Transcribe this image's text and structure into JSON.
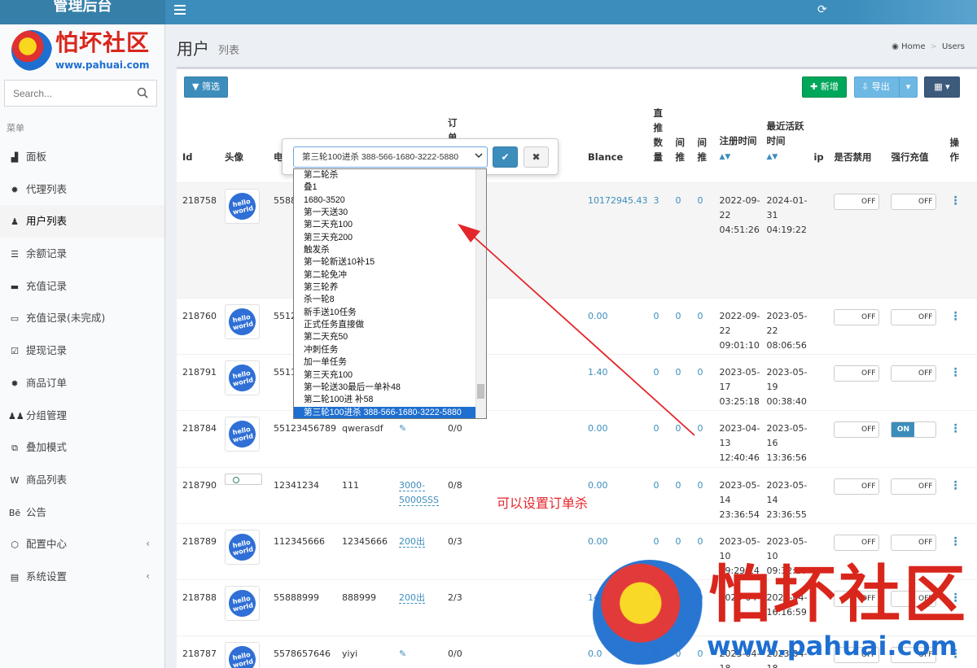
{
  "brand": {
    "title": "管理后台"
  },
  "logo": {
    "title": "怕坏社区",
    "url": "www.pahuai.com"
  },
  "search": {
    "placeholder": "Search..."
  },
  "sidebar": {
    "header": "菜单",
    "items": [
      {
        "label": "面板",
        "icon": "dashboard-icon"
      },
      {
        "label": "代理列表",
        "icon": "gear-icon"
      },
      {
        "label": "用户列表",
        "icon": "user-icon",
        "active": true
      },
      {
        "label": "余额记录",
        "icon": "list-icon"
      },
      {
        "label": "充值记录",
        "icon": "card-icon"
      },
      {
        "label": "充值记录(未完成)",
        "icon": "card-outline-icon"
      },
      {
        "label": "提现记录",
        "icon": "check-square-icon"
      },
      {
        "label": "商品订单",
        "icon": "gear-icon"
      },
      {
        "label": "分组管理",
        "icon": "users-icon"
      },
      {
        "label": "叠加模式",
        "icon": "layers-icon"
      },
      {
        "label": "商品列表",
        "icon": "product-icon"
      },
      {
        "label": "公告",
        "icon": "behance-icon"
      },
      {
        "label": "配置中心",
        "icon": "cog-icon",
        "chevron": true
      },
      {
        "label": "系统设置",
        "icon": "settings-icon",
        "chevron": true
      }
    ]
  },
  "header": {
    "title": "用户",
    "subtitle": "列表"
  },
  "breadcrumb": {
    "home": "Home",
    "current": "Users"
  },
  "toolbar": {
    "filter": "筛选",
    "add": "新增",
    "export": "导出"
  },
  "table": {
    "columns": {
      "id": "Id",
      "avatar": "头像",
      "phone": "电",
      "order": "订单",
      "balance": "Blance",
      "direct": "直推数量",
      "indirect1": "间推",
      "indirect2": "间推",
      "register": "注册时间",
      "last_active": "最近活跃时间",
      "ip": "ip",
      "disabled": "是否禁用",
      "force": "强行充值",
      "ops": "操作"
    },
    "rows": [
      {
        "id": "218758",
        "phone": "5588",
        "name": "",
        "task": "",
        "order": "",
        "balance": "10172945.43",
        "direct": "3",
        "i1": "0",
        "i2": "0",
        "reg_d": "2022-09-22",
        "reg_t": "04:51:26",
        "act_d": "2024-01-31",
        "act_t": "04:19:22",
        "disabled": "OFF",
        "force": "OFF"
      },
      {
        "id": "218760",
        "phone": "5512",
        "name": "",
        "task": "",
        "order": "",
        "balance": "0.00",
        "direct": "0",
        "i1": "0",
        "i2": "0",
        "reg_d": "2022-09-22",
        "reg_t": "09:01:10",
        "act_d": "2023-05-22",
        "act_t": "08:06:56",
        "disabled": "OFF",
        "force": "OFF"
      },
      {
        "id": "218791",
        "phone": "5511",
        "name": "",
        "task": "",
        "order": "",
        "balance": "1.40",
        "direct": "0",
        "i1": "0",
        "i2": "0",
        "reg_d": "2023-05-17",
        "reg_t": "03:25:18",
        "act_d": "2023-05-19",
        "act_t": "00:38:40",
        "disabled": "OFF",
        "force": "OFF"
      },
      {
        "id": "218784",
        "phone": "55123456789",
        "name": "qwerasdf",
        "task": "",
        "order": "0/0",
        "balance": "0.00",
        "direct": "0",
        "i1": "0",
        "i2": "0",
        "reg_d": "2023-04-13",
        "reg_t": "12:40:46",
        "act_d": "2023-05-16",
        "act_t": "13:36:56",
        "disabled": "OFF",
        "force": "ON"
      },
      {
        "id": "218790",
        "phone": "12341234",
        "name": "111",
        "task": "3000-5000SSS",
        "order": "0/8",
        "balance": "0.00",
        "direct": "0",
        "i1": "0",
        "i2": "0",
        "reg_d": "2023-05-14",
        "reg_t": "23:36:54",
        "act_d": "2023-05-14",
        "act_t": "23:36:55",
        "disabled": "OFF",
        "force": "OFF"
      },
      {
        "id": "218789",
        "phone": "112345666",
        "name": "12345666",
        "task": "200出",
        "order": "0/3",
        "balance": "0.00",
        "direct": "0",
        "i1": "0",
        "i2": "0",
        "reg_d": "2023-05-10",
        "reg_t": "09:29:14",
        "act_d": "2023-05-10",
        "act_t": "09:32:10",
        "disabled": "OFF",
        "force": "OFF"
      },
      {
        "id": "218788",
        "phone": "55888999",
        "name": "888999",
        "task": "200出",
        "order": "2/3",
        "balance": "143",
        "direct": "0",
        "i1": "0",
        "i2": "0",
        "reg_d": "2023-04-",
        "reg_t": "",
        "act_d": "2023-04-",
        "act_t": "16:16:59",
        "disabled": "OFF",
        "force": "OFF"
      },
      {
        "id": "218787",
        "phone": "5578657646",
        "name": "yiyi",
        "task": "",
        "order": "0/0",
        "balance": "0.0",
        "direct": "0",
        "i1": "0",
        "i2": "0",
        "reg_d": "2023-04-18",
        "reg_t": "",
        "act_d": "2023-04-18",
        "act_t": "",
        "disabled": "OFF",
        "force": "OFF"
      }
    ]
  },
  "avatar_text": "hello world",
  "popover": {
    "selected": "第三轮100进杀 388-566-1680-3222-5880",
    "options": [
      "第二轮杀",
      "叠1",
      "1680-3520",
      "第一天送30",
      "第二天充100",
      "第三天充200",
      "触发杀",
      "第一轮新送10补15",
      "第二轮免冲",
      "第三轮养",
      "杀一轮8",
      "新手送10任务",
      "正式任务直接做",
      "第二天充50",
      "冲刺任务",
      "加一单任务",
      "第三天充100",
      "第一轮送30最后一单补48",
      "第二轮100进 补58",
      "第三轮100进杀 388-566-1680-3222-5880"
    ]
  },
  "annotation": {
    "text": "可以设置订单杀"
  },
  "watermark": {
    "title": "怕坏社区",
    "url": "www.pahuai.com"
  },
  "colors": {
    "primary": "#3c8dbc",
    "success": "#00a65a",
    "annotation": "#e4262c"
  }
}
